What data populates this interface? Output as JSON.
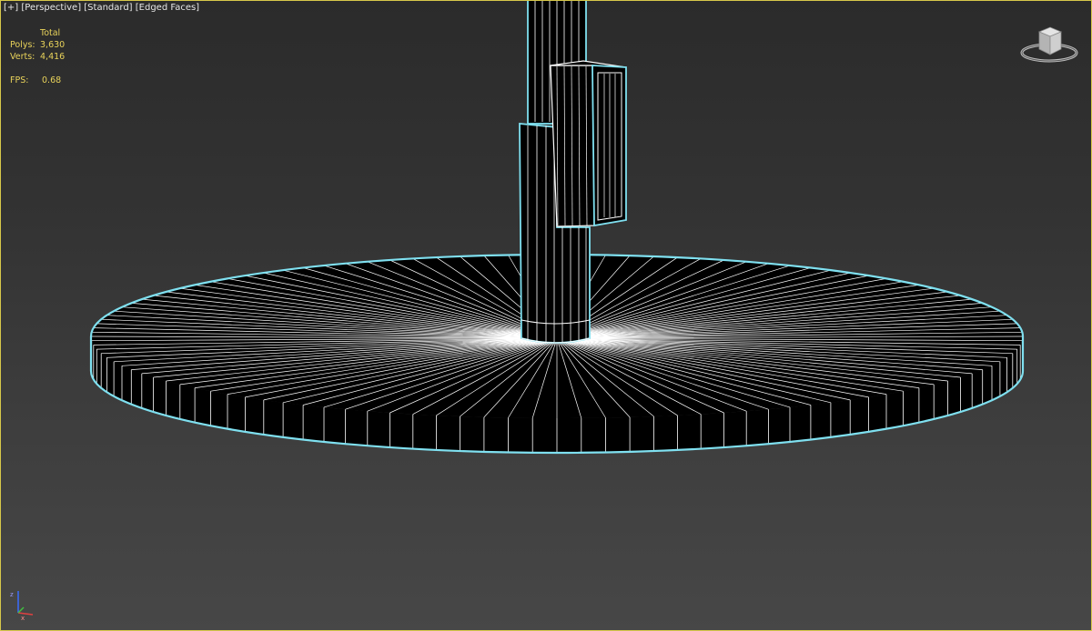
{
  "viewport": {
    "menu_plus": "[+]",
    "menu_view": "[Perspective]",
    "menu_shading": "[Standard]",
    "menu_display": "[Edged Faces]",
    "border_color": "#d7c84a",
    "selection_color": "#7fe0f0"
  },
  "stats": {
    "header": "Total",
    "polys_label": "Polys:",
    "polys_value": "3,630",
    "verts_label": "Verts:",
    "verts_value": "4,416",
    "fps_label": "FPS:",
    "fps_value": "0.68",
    "text_color": "#e8d25a"
  },
  "icons": {
    "viewcube": "viewcube-icon",
    "axis": "axis-tripod-icon"
  }
}
